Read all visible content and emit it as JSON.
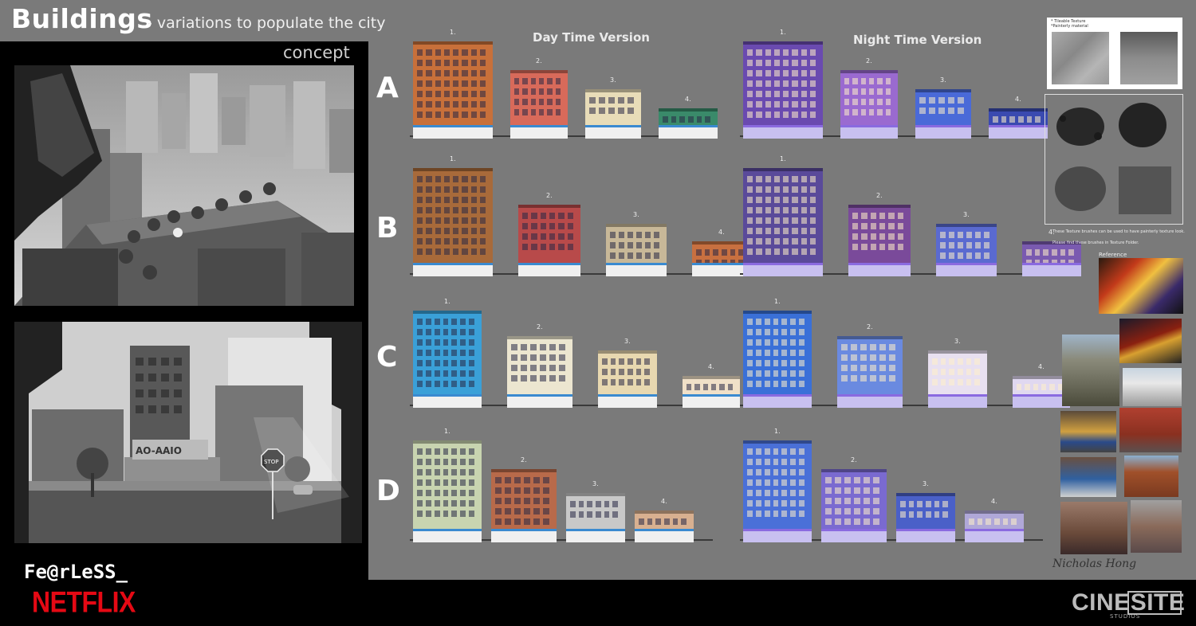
{
  "header": {
    "title": "Buildings",
    "subtitle": "- variations to populate the city"
  },
  "concept": {
    "label": "concept"
  },
  "columns": {
    "day_title": "Day Time Version",
    "night_title": "Night Time Version"
  },
  "rows": [
    "A",
    "B",
    "C",
    "D"
  ],
  "building_numbers": [
    "1.",
    "2.",
    "3.",
    "4."
  ],
  "right_panel": {
    "texture_note_line1": "* Tileable Texture",
    "texture_note_line2": "*Painterly material",
    "brush_note1": "These Texture brushes can be used to have painterly texture look.",
    "brush_note2": "Please find these brushes in Texture Folder.",
    "reference_label": "Reference"
  },
  "concept_signs": {
    "stop": "STOP",
    "storefront": "AO-AAIO"
  },
  "footer": {
    "fearless": "Fe@rLeSS_",
    "netflix": "NETFLIX",
    "cine": "CINE",
    "site": "SITE",
    "studios": "STUDIOS"
  },
  "signature": "Nicholas Hong",
  "palette": {
    "background": "#7a7a7a",
    "panel": "#000000",
    "netflix_red": "#e50914"
  }
}
